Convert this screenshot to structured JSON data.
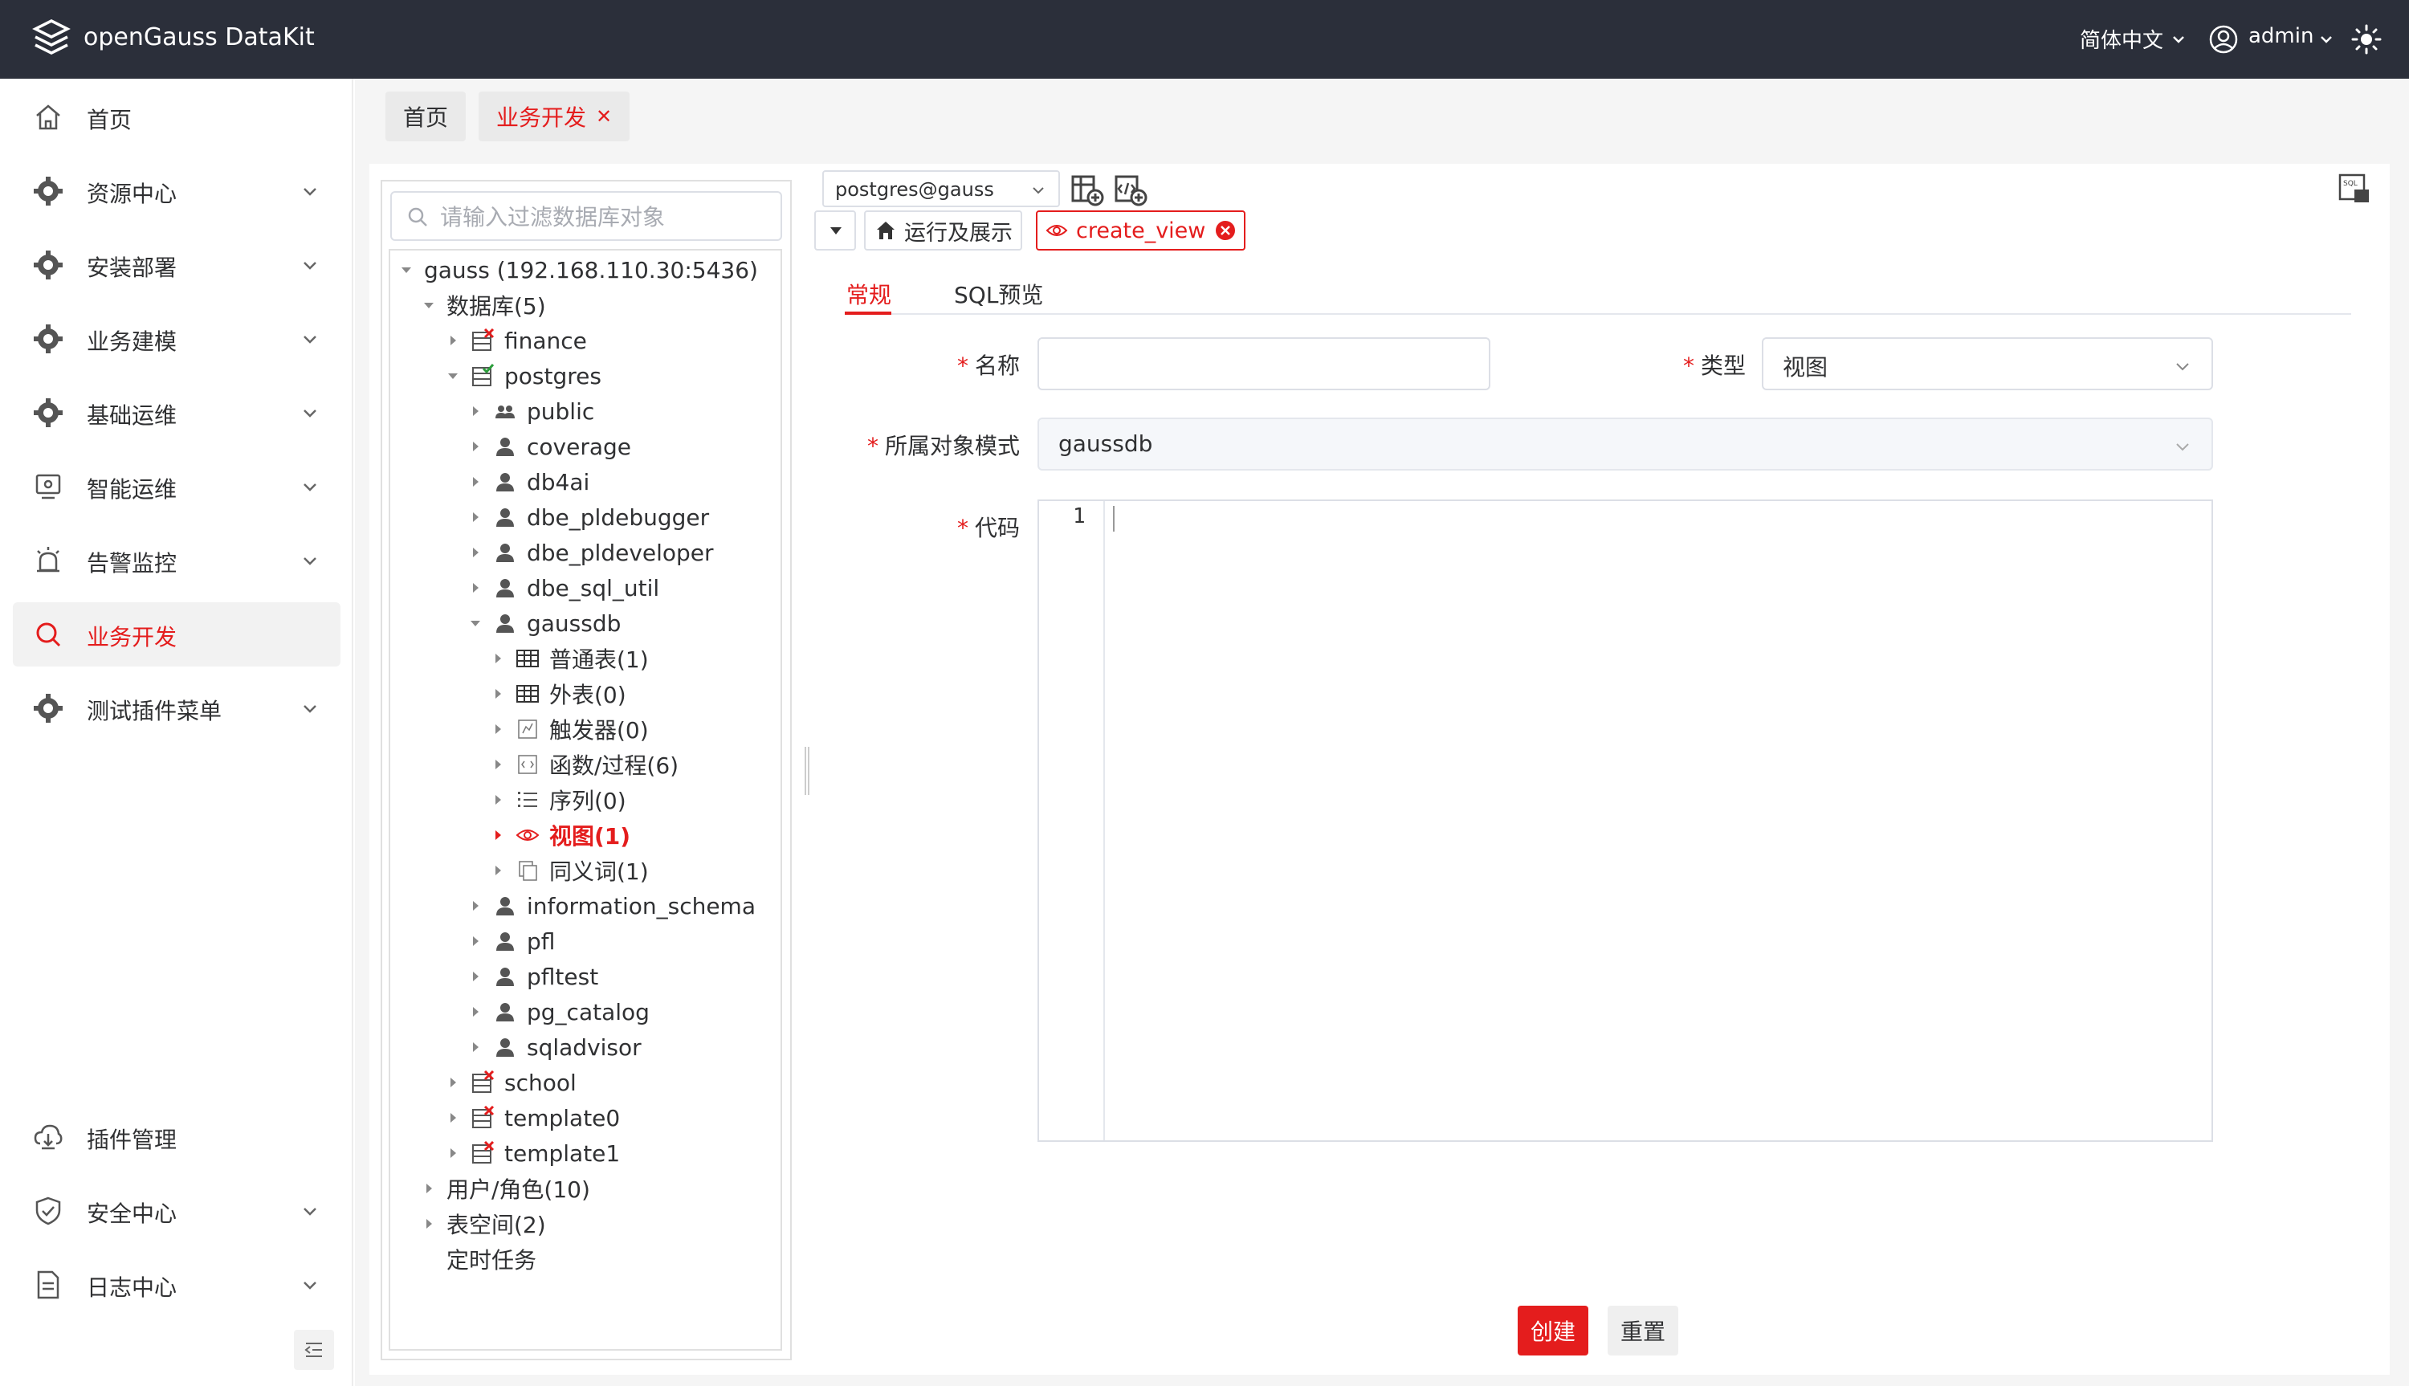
{
  "app": {
    "title": "openGauss DataKit",
    "language": "简体中文",
    "user": "admin"
  },
  "sidebar": {
    "items": [
      {
        "label": "首页",
        "icon": "home-icon",
        "expandable": false
      },
      {
        "label": "资源中心",
        "icon": "gear-icon",
        "expandable": true
      },
      {
        "label": "安装部署",
        "icon": "gear-icon",
        "expandable": true
      },
      {
        "label": "业务建模",
        "icon": "gear-icon",
        "expandable": true
      },
      {
        "label": "基础运维",
        "icon": "gear-icon",
        "expandable": true
      },
      {
        "label": "智能运维",
        "icon": "monitor-icon",
        "expandable": true
      },
      {
        "label": "告警监控",
        "icon": "alarm-icon",
        "expandable": true
      },
      {
        "label": "业务开发",
        "icon": "search-icon",
        "expandable": false,
        "active": true
      },
      {
        "label": "测试插件菜单",
        "icon": "gear-icon",
        "expandable": true
      }
    ],
    "bottom_items": [
      {
        "label": "插件管理",
        "icon": "plugin-icon",
        "expandable": false
      },
      {
        "label": "安全中心",
        "icon": "shield-icon",
        "expandable": true
      },
      {
        "label": "日志中心",
        "icon": "document-icon",
        "expandable": true
      }
    ]
  },
  "tabs": [
    {
      "label": "首页"
    },
    {
      "label": "业务开发",
      "active": true
    }
  ],
  "tree": {
    "filter_placeholder": "请输入过滤数据库对象",
    "nodes": [
      {
        "label": "gauss (192.168.110.30:5436)",
        "level": 0,
        "arrow": "down",
        "icon": "none"
      },
      {
        "label": "数据库(5)",
        "level": 1,
        "arrow": "down",
        "icon": "none"
      },
      {
        "label": "finance",
        "level": 2,
        "arrow": "right",
        "icon": "db-closed"
      },
      {
        "label": "postgres",
        "level": 2,
        "arrow": "down",
        "icon": "db-open"
      },
      {
        "label": "public",
        "level": 3,
        "arrow": "right",
        "icon": "users"
      },
      {
        "label": "coverage",
        "level": 3,
        "arrow": "right",
        "icon": "user"
      },
      {
        "label": "db4ai",
        "level": 3,
        "arrow": "right",
        "icon": "user"
      },
      {
        "label": "dbe_pldebugger",
        "level": 3,
        "arrow": "right",
        "icon": "user"
      },
      {
        "label": "dbe_pldeveloper",
        "level": 3,
        "arrow": "right",
        "icon": "user"
      },
      {
        "label": "dbe_sql_util",
        "level": 3,
        "arrow": "right",
        "icon": "user"
      },
      {
        "label": "gaussdb",
        "level": 3,
        "arrow": "down",
        "icon": "user"
      },
      {
        "label": "普通表(1)",
        "level": 4,
        "arrow": "right",
        "icon": "table"
      },
      {
        "label": "外表(0)",
        "level": 4,
        "arrow": "right",
        "icon": "table"
      },
      {
        "label": "触发器(0)",
        "level": 4,
        "arrow": "right",
        "icon": "trigger"
      },
      {
        "label": "函数/过程(6)",
        "level": 4,
        "arrow": "right",
        "icon": "function"
      },
      {
        "label": "序列(0)",
        "level": 4,
        "arrow": "right",
        "icon": "sequence"
      },
      {
        "label": "视图(1)",
        "level": 4,
        "arrow": "right",
        "icon": "view",
        "active": true
      },
      {
        "label": "同义词(1)",
        "level": 4,
        "arrow": "right",
        "icon": "synonym"
      },
      {
        "label": "information_schema",
        "level": 3,
        "arrow": "right",
        "icon": "user"
      },
      {
        "label": "pfl",
        "level": 3,
        "arrow": "right",
        "icon": "user"
      },
      {
        "label": "pfltest",
        "level": 3,
        "arrow": "right",
        "icon": "user"
      },
      {
        "label": "pg_catalog",
        "level": 3,
        "arrow": "right",
        "icon": "user"
      },
      {
        "label": "sqladvisor",
        "level": 3,
        "arrow": "right",
        "icon": "user"
      },
      {
        "label": "school",
        "level": 2,
        "arrow": "right",
        "icon": "db-closed"
      },
      {
        "label": "template0",
        "level": 2,
        "arrow": "right",
        "icon": "db-closed"
      },
      {
        "label": "template1",
        "level": 2,
        "arrow": "right",
        "icon": "db-closed"
      },
      {
        "label": "用户/角色(10)",
        "level": 1,
        "arrow": "right",
        "icon": "none"
      },
      {
        "label": "表空间(2)",
        "level": 1,
        "arrow": "right",
        "icon": "none"
      },
      {
        "label": "定时任务",
        "level": 1,
        "arrow": "none",
        "icon": "none"
      }
    ]
  },
  "editor": {
    "connection": "postgres@gauss",
    "run_tab": "运行及展示",
    "view_tab": "create_view",
    "subtabs": [
      "常规",
      "SQL预览"
    ],
    "form": {
      "name_label": "名称",
      "name_value": "",
      "type_label": "类型",
      "type_value": "视图",
      "schema_label": "所属对象模式",
      "schema_value": "gaussdb",
      "code_label": "代码",
      "line_number": "1"
    },
    "create_button": "创建",
    "reset_button": "重置"
  },
  "colors": {
    "accent": "#e41d1d",
    "topbar": "#2b2f3a"
  }
}
